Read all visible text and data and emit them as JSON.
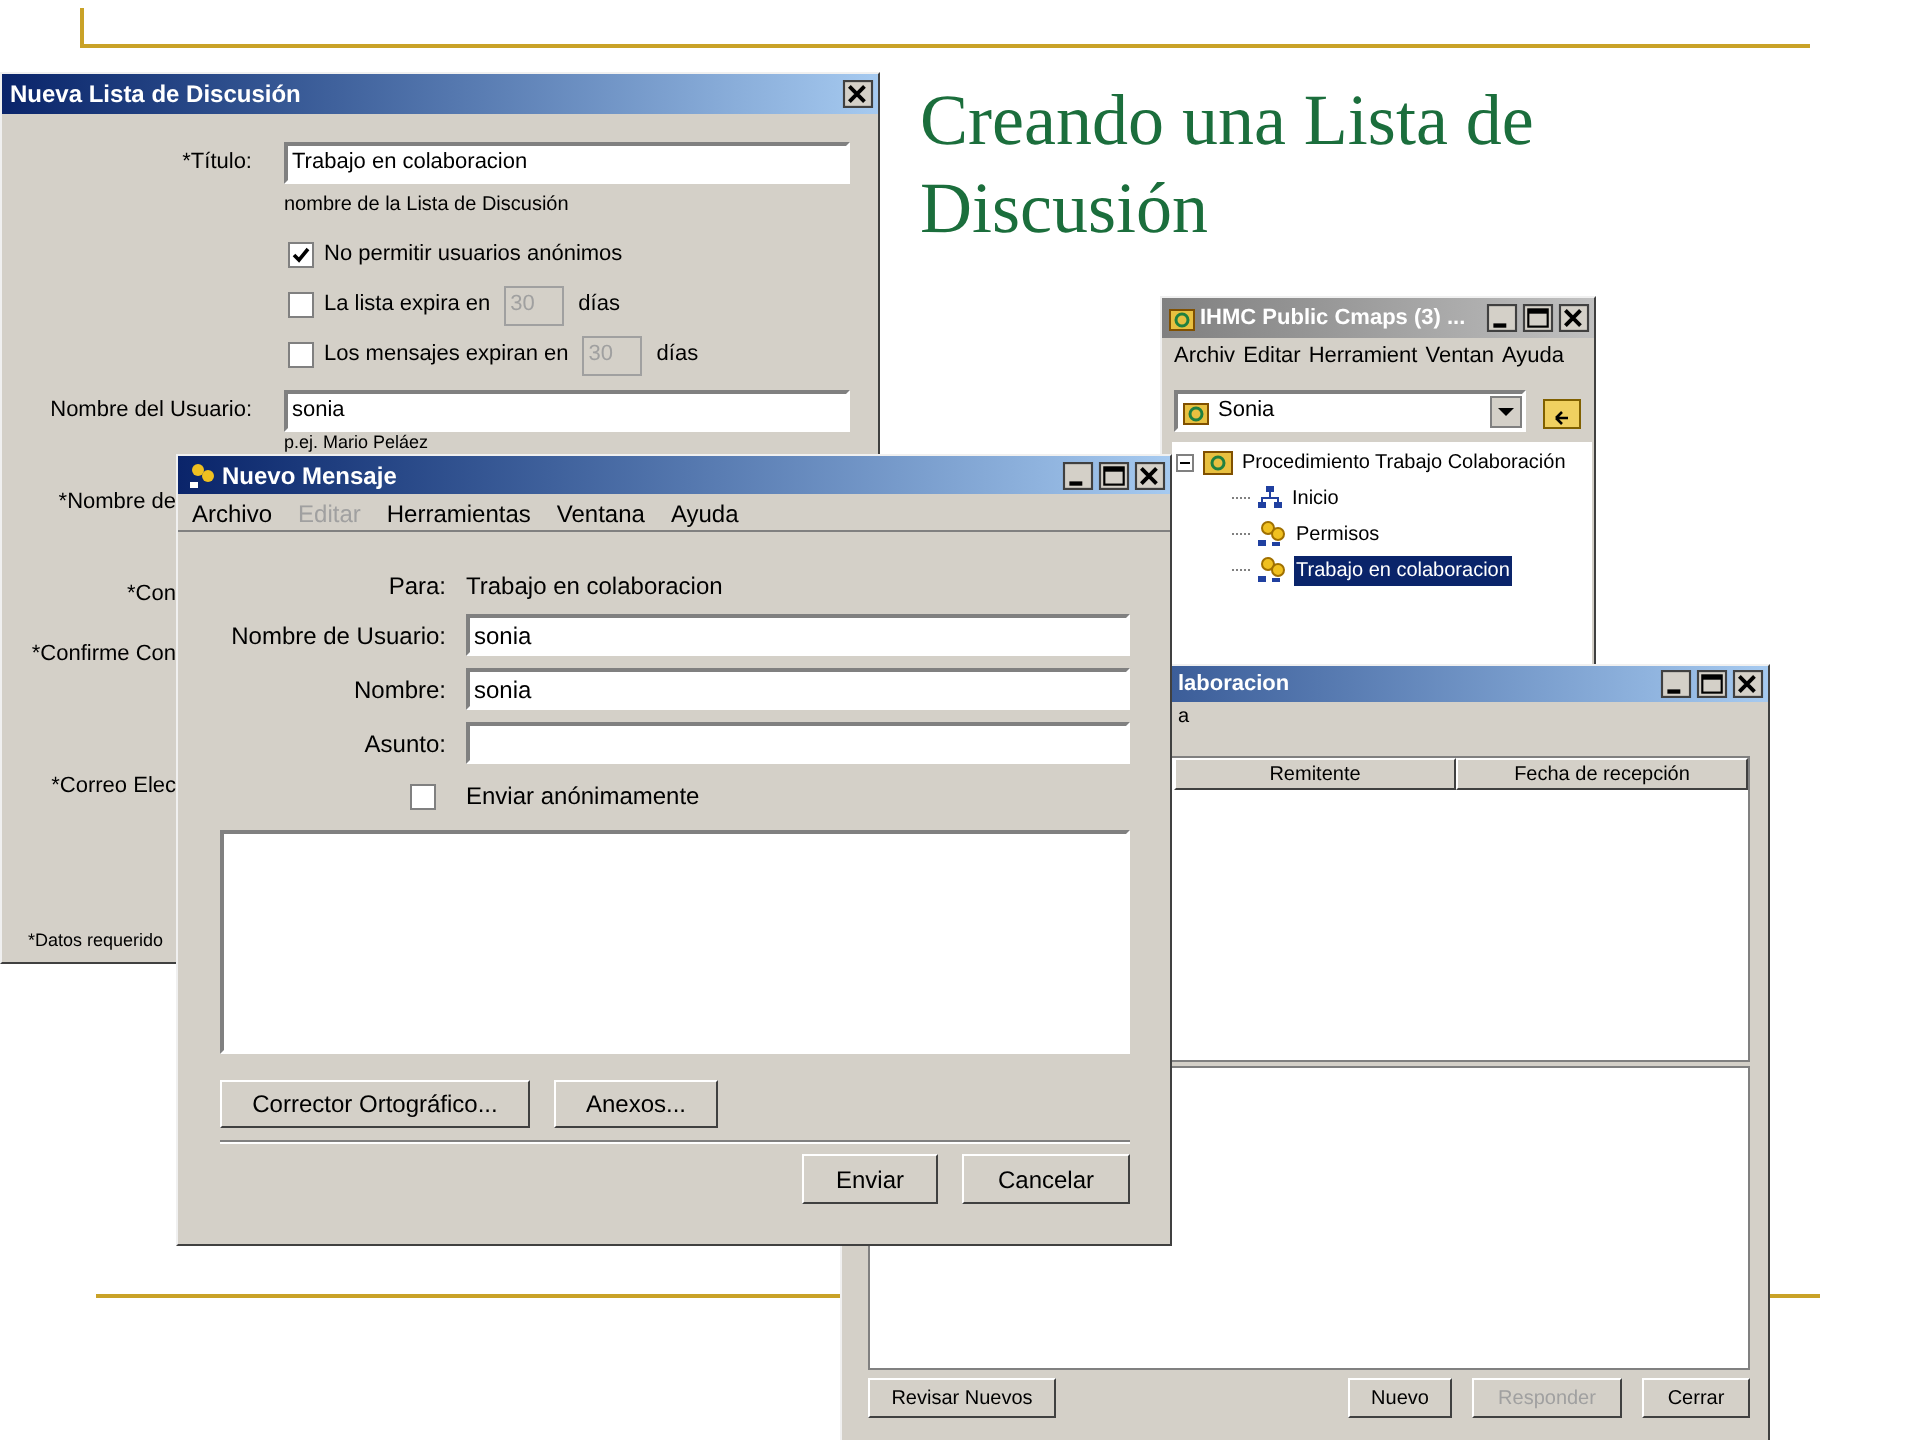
{
  "slide": {
    "title": "Creando una Lista de Discusión"
  },
  "list_window": {
    "title": "Nueva Lista de Discusión",
    "title_field": {
      "label": "*Título:",
      "value": "Trabajo en colaboracion",
      "hint": "nombre de la Lista de Discusión"
    },
    "options": [
      {
        "label": "No permitir usuarios anónimos",
        "checked": true
      },
      {
        "label": "La lista expira en",
        "checked": false,
        "value": "30",
        "unit": "días"
      },
      {
        "label": "Los mensajes expiran en",
        "checked": false,
        "value": "30",
        "unit": "días"
      }
    ],
    "user_field": {
      "label": "Nombre del Usuario:",
      "value": "sonia",
      "hint": "p.ej. Mario Peláez"
    },
    "covered_labels": [
      "*Nombre de",
      "*Con",
      "*Confirme Con",
      "*Correo Elec"
    ],
    "footnote": "*Datos requerido"
  },
  "cmaps_window": {
    "title": "IHMC Public Cmaps (3) ...",
    "menu": [
      "Archiv",
      "Editar",
      "Herramient",
      "Ventan",
      "Ayuda"
    ],
    "location": "Sonia",
    "tree": [
      {
        "label": "Procedimiento Trabajo Colaboración",
        "kind": "folder",
        "expanded": true,
        "selected": false,
        "children": [
          {
            "label": "Inicio",
            "kind": "map",
            "selected": false
          },
          {
            "label": "Permisos",
            "kind": "list",
            "selected": false
          },
          {
            "label": "Trabajo en colaboracion",
            "kind": "list",
            "selected": true
          }
        ]
      }
    ]
  },
  "list_view_window": {
    "title": "laboracion",
    "menu": [
      "a"
    ],
    "columns": [
      "Remitente",
      "Fecha de recepción"
    ],
    "buttons": [
      {
        "label": "Revisar Nuevos",
        "disabled": false
      },
      {
        "label": "Nuevo",
        "disabled": false
      },
      {
        "label": "Responder",
        "disabled": true
      },
      {
        "label": "Cerrar",
        "disabled": false
      }
    ]
  },
  "message_window": {
    "title": "Nuevo Mensaje",
    "menu": [
      {
        "label": "Archivo",
        "disabled": false
      },
      {
        "label": "Editar",
        "disabled": true
      },
      {
        "label": "Herramientas",
        "disabled": false
      },
      {
        "label": "Ventana",
        "disabled": false
      },
      {
        "label": "Ayuda",
        "disabled": false
      }
    ],
    "to": {
      "label": "Para:",
      "value": "Trabajo en colaboracion"
    },
    "fields": [
      {
        "label": "Nombre de Usuario:",
        "value": "sonia"
      },
      {
        "label": "Nombre:",
        "value": "sonia"
      },
      {
        "label": "Asunto:"
      }
    ],
    "anonymous": {
      "label": "Enviar anónimamente",
      "checked": false
    },
    "tool_buttons": [
      "Corrector Ortográfico...",
      "Anexos..."
    ],
    "action_buttons": [
      "Enviar",
      "Cancelar"
    ]
  }
}
